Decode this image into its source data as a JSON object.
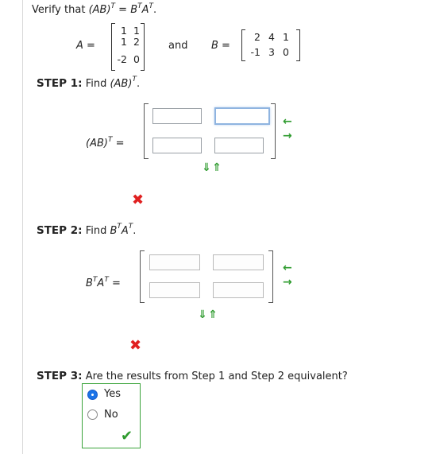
{
  "header": {
    "prefix": "Verify that",
    "lhs": "(AB)",
    "lhs_sup": "T",
    "eq": " = ",
    "rhs": "B",
    "rhs_sup1": "T",
    "rhs2": "A",
    "rhs_sup2": "T",
    "suffix": "."
  },
  "matrixA": {
    "label": "A =",
    "rows": [
      [
        "1",
        "1"
      ],
      [
        "1",
        "2"
      ],
      [
        "-2",
        "0"
      ]
    ]
  },
  "and_text": "and",
  "matrixB": {
    "label": "B =",
    "rows": [
      [
        "2",
        "4",
        "1"
      ],
      [
        "-1",
        "3",
        "0"
      ]
    ]
  },
  "step1": {
    "label": "STEP 1:",
    "text": "Find ",
    "expr": "(AB)",
    "sup": "T",
    "end": ".",
    "matrix_label": "(AB)",
    "matrix_sup": "T",
    "matrix_eq": " ="
  },
  "step2": {
    "label": "STEP 2:",
    "text": "Find ",
    "expr_b": "B",
    "sup1": "T",
    "expr_a": "A",
    "sup2": "T",
    "end": ".",
    "matrix_label_b": "B",
    "matrix_sup1": "T",
    "matrix_label_a": "A",
    "matrix_sup2": "T",
    "matrix_eq": " ="
  },
  "step3": {
    "label": "STEP 3:",
    "question": "Are the results from Step 1 and Step 2 equivalent?",
    "options": [
      "Yes",
      "No"
    ],
    "selected": "Yes"
  },
  "icons": {
    "left_arrow": "←",
    "right_arrow": "→",
    "down_arrow": "⇓",
    "up_arrow": "⇑",
    "wrong": "✖",
    "correct": "✔"
  },
  "colors": {
    "accent_green": "#2e9b2e",
    "error_red": "#e02020",
    "focus_blue": "#8fb4e0",
    "radio_selected": "#1a73e8"
  }
}
